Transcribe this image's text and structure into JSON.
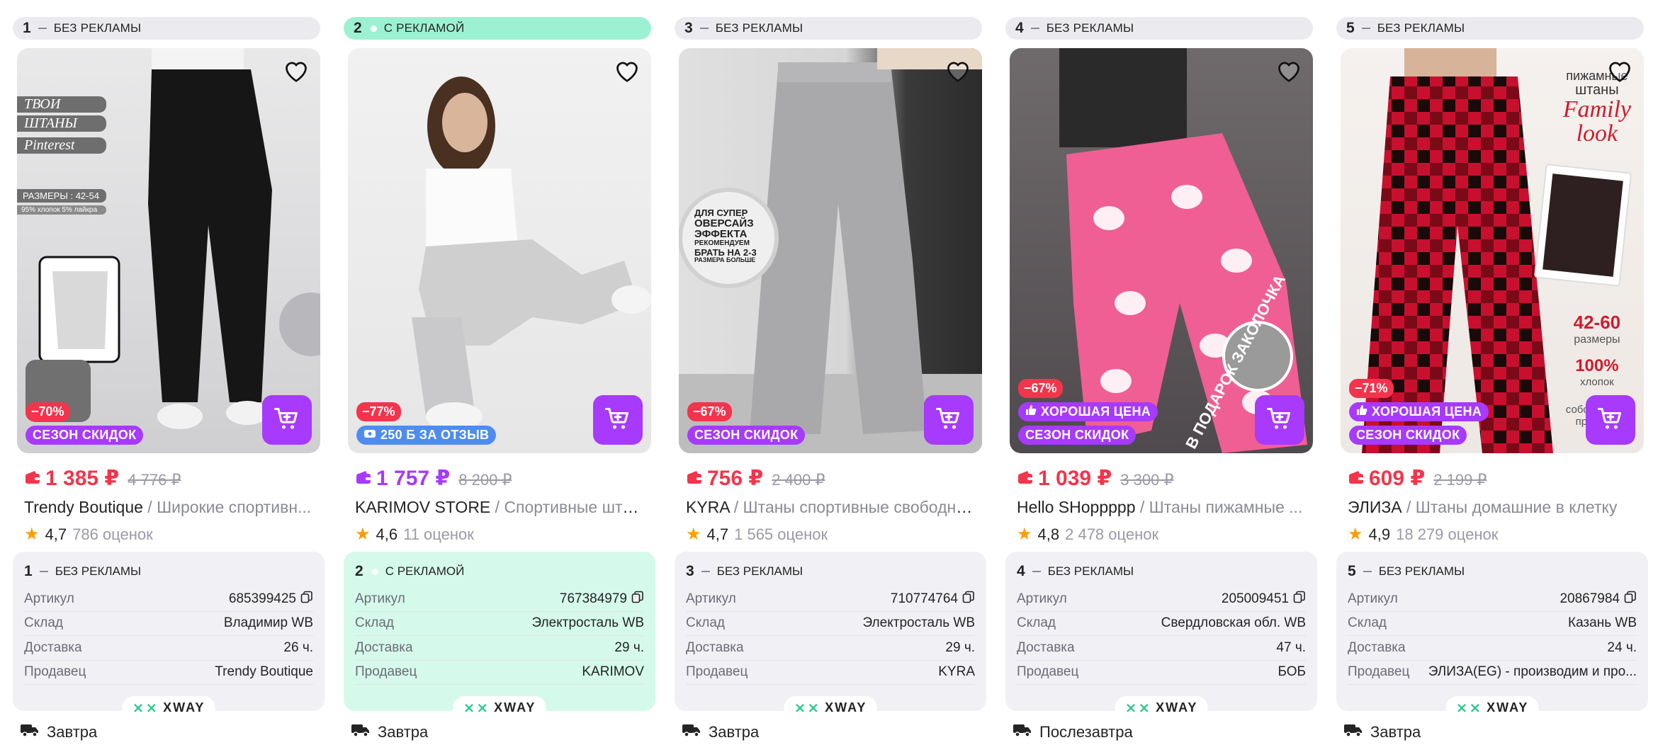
{
  "colors": {
    "accent": "#a73afd",
    "sale": "#f2354c",
    "ad_bg": "#9df1d3",
    "star": "#ff9c00"
  },
  "cards": [
    {
      "position": "1",
      "ad_label": "БЕЗ РЕКЛАМЫ",
      "is_ad": false,
      "discount": "−70%",
      "tags": [
        "СЕЗОН СКИДОК"
      ],
      "tag_types": [
        "season"
      ],
      "price": "1 385 ₽",
      "old_price": "4 776 ₽",
      "brand": "Trendy Boutique",
      "name": " / Широкие спортивн...",
      "rating": "4,7",
      "reviews": "786 оценок",
      "info": {
        "article": "685399425",
        "warehouse": "Владимир WB",
        "delivery_time": "26 ч.",
        "seller": "Trendy Boutique"
      },
      "delivery": "Завтра"
    },
    {
      "position": "2",
      "ad_label": "С РЕКЛАМОЙ",
      "is_ad": true,
      "discount": "−77%",
      "tags": [
        "250 Б ЗА ОТЗЫВ"
      ],
      "tag_types": [
        "review"
      ],
      "price": "1 757 ₽",
      "old_price": "8 200 ₽",
      "brand": "KARIMOV STORE",
      "name": " / Спортивные штан...",
      "rating": "4,6",
      "reviews": "11 оценок",
      "info": {
        "article": "767384979",
        "warehouse": "Электросталь WB",
        "delivery_time": "29 ч.",
        "seller": "KARIMOV"
      },
      "delivery": "Завтра"
    },
    {
      "position": "3",
      "ad_label": "БЕЗ РЕКЛАМЫ",
      "is_ad": false,
      "discount": "−67%",
      "tags": [
        "СЕЗОН СКИДОК"
      ],
      "tag_types": [
        "season"
      ],
      "price": "756 ₽",
      "old_price": "2 400 ₽",
      "brand": "KYRA",
      "name": " / Штаны спортивные свободны...",
      "rating": "4,7",
      "reviews": "1 565 оценок",
      "info": {
        "article": "710774764",
        "warehouse": "Электросталь WB",
        "delivery_time": "29 ч.",
        "seller": "KYRA"
      },
      "delivery": "Завтра"
    },
    {
      "position": "4",
      "ad_label": "БЕЗ РЕКЛАМЫ",
      "is_ad": false,
      "discount": "−67%",
      "tags": [
        "ХОРОШАЯ ЦЕНА",
        "СЕЗОН СКИДОК"
      ],
      "tag_types": [
        "good",
        "season"
      ],
      "price": "1 039 ₽",
      "old_price": "3 300 ₽",
      "brand": "Hello SHoppppp",
      "name": " / Штаны пижамные ...",
      "rating": "4,8",
      "reviews": "2 478 оценок",
      "info": {
        "article": "205009451",
        "warehouse": "Свердловская обл. WB",
        "delivery_time": "47 ч.",
        "seller": "БОБ"
      },
      "delivery": "Послезавтра"
    },
    {
      "position": "5",
      "ad_label": "БЕЗ РЕКЛАМЫ",
      "is_ad": false,
      "discount": "−71%",
      "tags": [
        "ХОРОШАЯ ЦЕНА",
        "СЕЗОН СКИДОК"
      ],
      "tag_types": [
        "good",
        "season"
      ],
      "price": "609 ₽",
      "old_price": "2 199 ₽",
      "brand": "ЭЛИЗА",
      "name": " / Штаны домашние в клетку",
      "rating": "4,9",
      "reviews": "18 279 оценок",
      "info": {
        "article": "20867984",
        "warehouse": "Казань WB",
        "delivery_time": "24 ч.",
        "seller": "ЭЛИЗА(EG) - производим и про..."
      },
      "delivery": "Завтра"
    }
  ],
  "labels": {
    "article": "Артикул",
    "warehouse": "Склад",
    "delivery_time": "Доставка",
    "seller": "Продавец",
    "xway": "XWAY"
  },
  "overlay_text": {
    "card1": [
      "ТВОИ",
      "ШТАНЫ",
      "Pinterest",
      "РАЗМЕРЫ : 42-54",
      "95% хлопок 5% лайкра"
    ],
    "card3": [
      "ДЛЯ СУПЕР",
      "ОВЕРСАЙЗ",
      "ЭФФЕКТА",
      "РЕКОМЕНДУЕМ",
      "БРАТЬ НА 2-3",
      "РАЗМЕРА БОЛЬШЕ"
    ],
    "card4": [
      "В ПОДАРОК ЗАКОЛОЧКА"
    ],
    "card5": [
      "пижамные",
      "штаны",
      "Family",
      "look",
      "42-60",
      "размеры",
      "100%",
      "хлопок",
      "собственное",
      "произв..."
    ]
  }
}
